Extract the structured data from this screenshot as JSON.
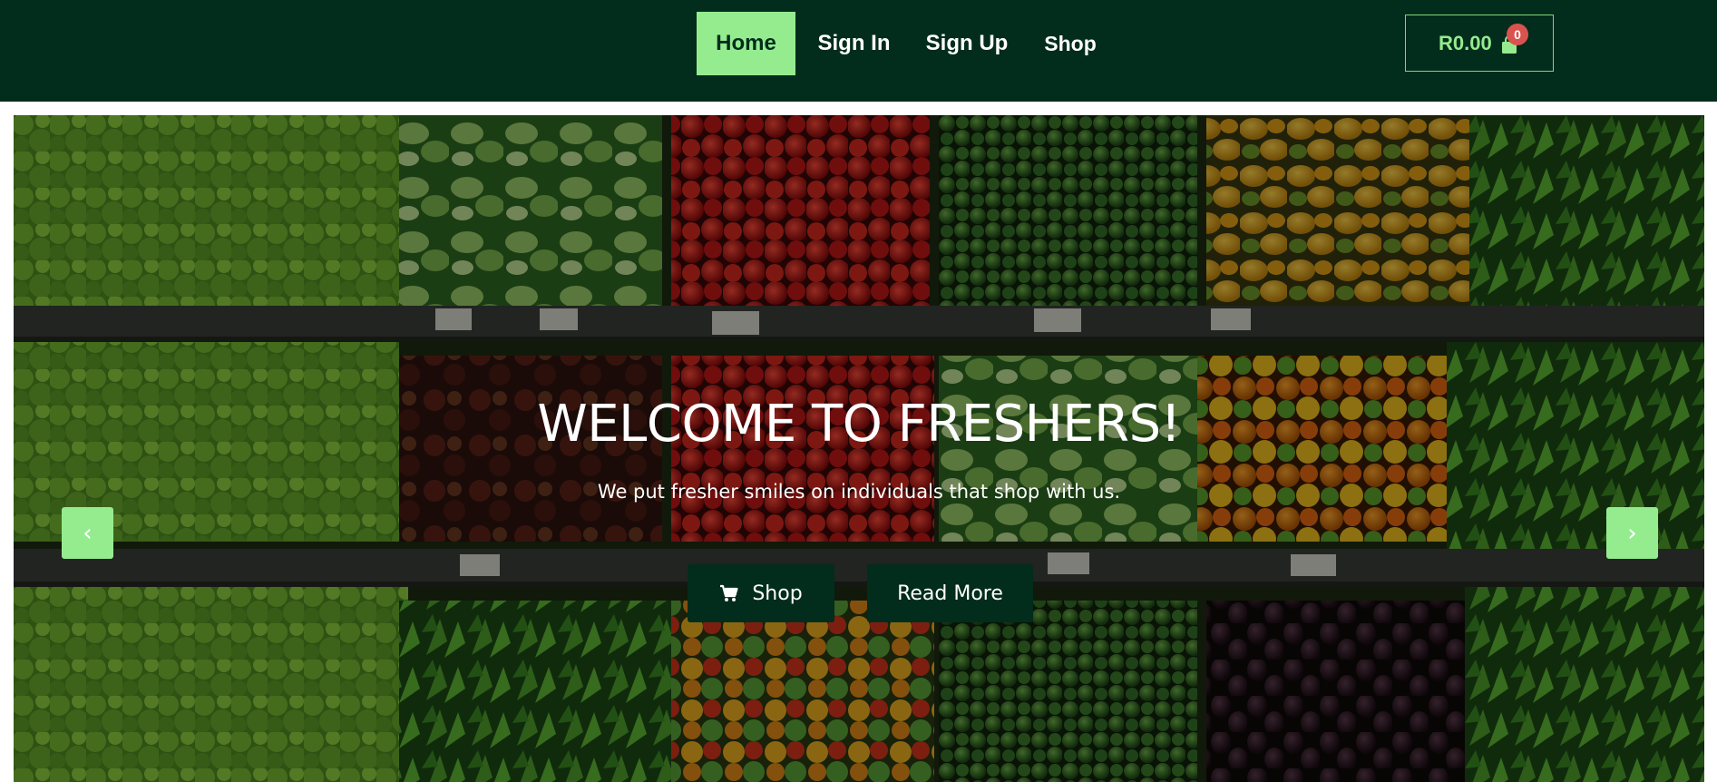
{
  "nav": {
    "items": [
      {
        "label": "Home"
      },
      {
        "label": "Sign In"
      },
      {
        "label": "Sign Up"
      },
      {
        "label": "Shop"
      }
    ],
    "active": "Home"
  },
  "cart": {
    "total": "R0.00",
    "count": "0",
    "icon": "shopping-bag-icon"
  },
  "hero": {
    "title": "WELCOME TO FRESHERS!",
    "subtitle": "We put fresher smiles on individuals that shop with us.",
    "shop_button": "Shop",
    "shop_icon": "cart-icon",
    "read_more_button": "Read More",
    "prev_arrow": "‹",
    "next_arrow": "›"
  },
  "colors": {
    "nav_bg": "#022c1c",
    "accent": "#94ec8f",
    "badge": "#d9534f",
    "button_bg": "#022c1c"
  }
}
